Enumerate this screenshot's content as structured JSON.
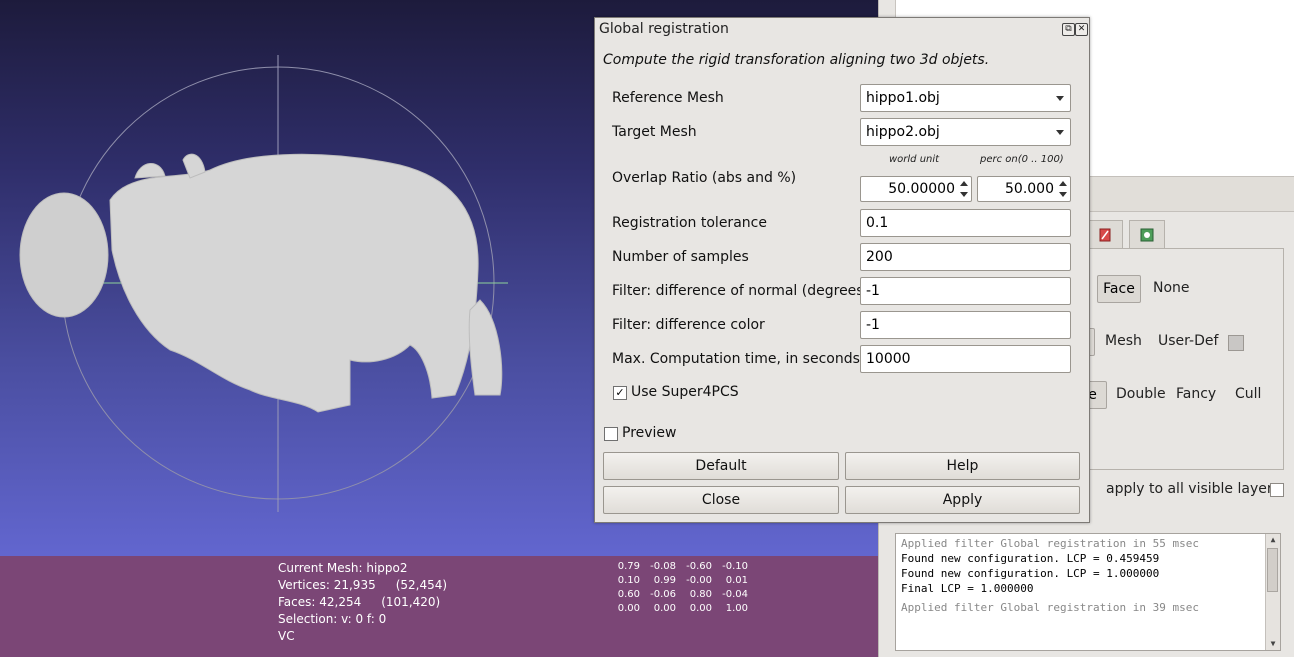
{
  "colors": {
    "viewport_top": "#1d1b3c",
    "viewport_bottom": "#6266cf",
    "infobar": "#7b4676",
    "mesh": "#d6d6d6"
  },
  "info": {
    "current_mesh": "Current Mesh: hippo2",
    "vertices": "Vertices: 21,935",
    "vertices_total": "(52,454)",
    "faces": "Faces: 42,254",
    "faces_total": "(101,420)",
    "selection": "Selection: v: 0 f: 0",
    "vc": "VC"
  },
  "matrix": [
    [
      "0.79",
      "-0.08",
      "-0.60",
      "-0.10"
    ],
    [
      "0.10",
      "0.99",
      "-0.00",
      "0.01"
    ],
    [
      "0.60",
      "-0.06",
      "0.80",
      "-0.04"
    ],
    [
      "0.00",
      "0.00",
      "0.00",
      "1.00"
    ]
  ],
  "panel": {
    "face_btn": "Face",
    "none_label": "None",
    "mesh_label": "Mesh",
    "userdef_label": "User-Def",
    "e_btn": "e",
    "double_label": "Double",
    "fancy_label": "Fancy",
    "cull_label": "Cull",
    "apply_all_label": "apply to all visible layers",
    "tab_icons": [
      "brush-icon",
      "gear-icon"
    ]
  },
  "log": [
    {
      "text": "Applied filter Global registration in 55 msec",
      "gray": true
    },
    {
      "text": "Found new configuration. LCP = 0.459459",
      "gray": false
    },
    {
      "text": "Found new configuration. LCP = 1.000000",
      "gray": false
    },
    {
      "text": "Final LCP = 1.000000",
      "gray": false
    },
    {
      "text": "Applied filter Global registration in 39 msec",
      "gray": true
    }
  ],
  "dialog": {
    "title": "Global registration",
    "description": "Compute the rigid transforation aligning two 3d objets.",
    "reference_mesh_label": "Reference Mesh",
    "reference_mesh_value": "hippo1.obj",
    "target_mesh_label": "Target Mesh",
    "target_mesh_value": "hippo2.obj",
    "world_unit_label": "world unit",
    "perc_label": "perc on(0 .. 100)",
    "overlap_label": "Overlap Ratio (abs and %)",
    "overlap_abs": "50.00000",
    "overlap_pct": "50.000",
    "tolerance_label": "Registration tolerance",
    "tolerance_value": "0.1",
    "samples_label": "Number of samples",
    "samples_value": "200",
    "normal_label": "Filter: difference of normal (degrees)",
    "normal_value": "-1",
    "color_label": "Filter: difference color",
    "color_value": "-1",
    "maxtime_label": "Max. Computation time, in seconds",
    "maxtime_value": "10000",
    "super4pcs_label": "Use Super4PCS",
    "super4pcs_checked": "✓",
    "preview_label": "Preview",
    "default_btn": "Default",
    "help_btn": "Help",
    "close_btn": "Close",
    "apply_btn": "Apply"
  }
}
